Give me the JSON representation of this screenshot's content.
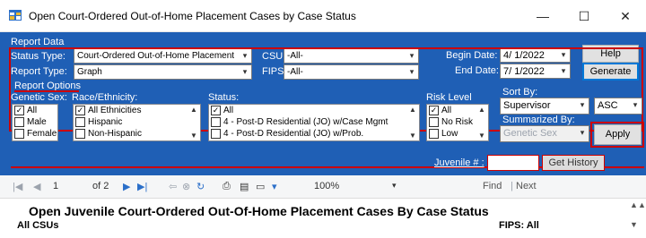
{
  "window": {
    "title": "Open Court-Ordered Out-of-Home Placement Cases by Case Status",
    "minimize": "—",
    "maximize": "☐",
    "close": "✕"
  },
  "report_data": {
    "section_label": "Report Data",
    "status_type_label": "Status Type:",
    "status_type_value": "Court-Ordered Out-of-Home Placement",
    "report_type_label": "Report Type:",
    "report_type_value": "Graph",
    "csu_label": "CSU:",
    "csu_value": "-All-",
    "fips_label": "FIPS:",
    "fips_value": "-All-",
    "begin_date_label": "Begin Date:",
    "begin_date_value": "4/ 1/2022",
    "end_date_label": "End Date:",
    "end_date_value": "7/ 1/2022",
    "help_label": "Help",
    "generate_label": "Generate"
  },
  "report_options": {
    "section_label": "Report Options",
    "genetic_sex_label": "Genetic Sex:",
    "genetic_sex_items": [
      {
        "label": "All",
        "checked": true
      },
      {
        "label": "Male",
        "checked": false
      },
      {
        "label": "Female",
        "checked": false
      }
    ],
    "race_label": "Race/Ethnicity:",
    "race_items": [
      {
        "label": "All Ethnicities",
        "checked": true
      },
      {
        "label": "Hispanic",
        "checked": false
      },
      {
        "label": "Non-Hispanic",
        "checked": false
      }
    ],
    "status_label": "Status:",
    "status_items": [
      {
        "label": "All",
        "checked": true
      },
      {
        "label": "4 - Post-D Residential (JO) w/Case Mgmt",
        "checked": false
      },
      {
        "label": "4 - Post-D Residential (JO) w/Prob.",
        "checked": false
      }
    ],
    "risk_label": "Risk Level",
    "risk_items": [
      {
        "label": "All",
        "checked": true
      },
      {
        "label": "No Risk",
        "checked": false
      },
      {
        "label": "Low",
        "checked": false
      }
    ],
    "sort_by_label": "Sort By:",
    "sort_by_value": "Supervisor",
    "sort_dir_value": "ASC",
    "summarized_by_label": "Summarized By:",
    "summarized_by_value": "Genetic Sex",
    "apply_label": "Apply"
  },
  "juvenile": {
    "label": "Juvenile # :",
    "value": "",
    "get_history_label": "Get History"
  },
  "viewer": {
    "page_current": "1",
    "page_of": "of 2",
    "zoom": "100%",
    "find_label": "Find",
    "next_label": "Next",
    "report_title": "Open Juvenile Court-Ordered Out-Of-Home Placement Cases By Case Status",
    "left_header": "All CSUs",
    "right_header": "FIPS: All"
  },
  "colors": {
    "form_bg": "#1f5fb5",
    "highlight": "#cc0000",
    "disabled_text": "#9ca3ad"
  }
}
